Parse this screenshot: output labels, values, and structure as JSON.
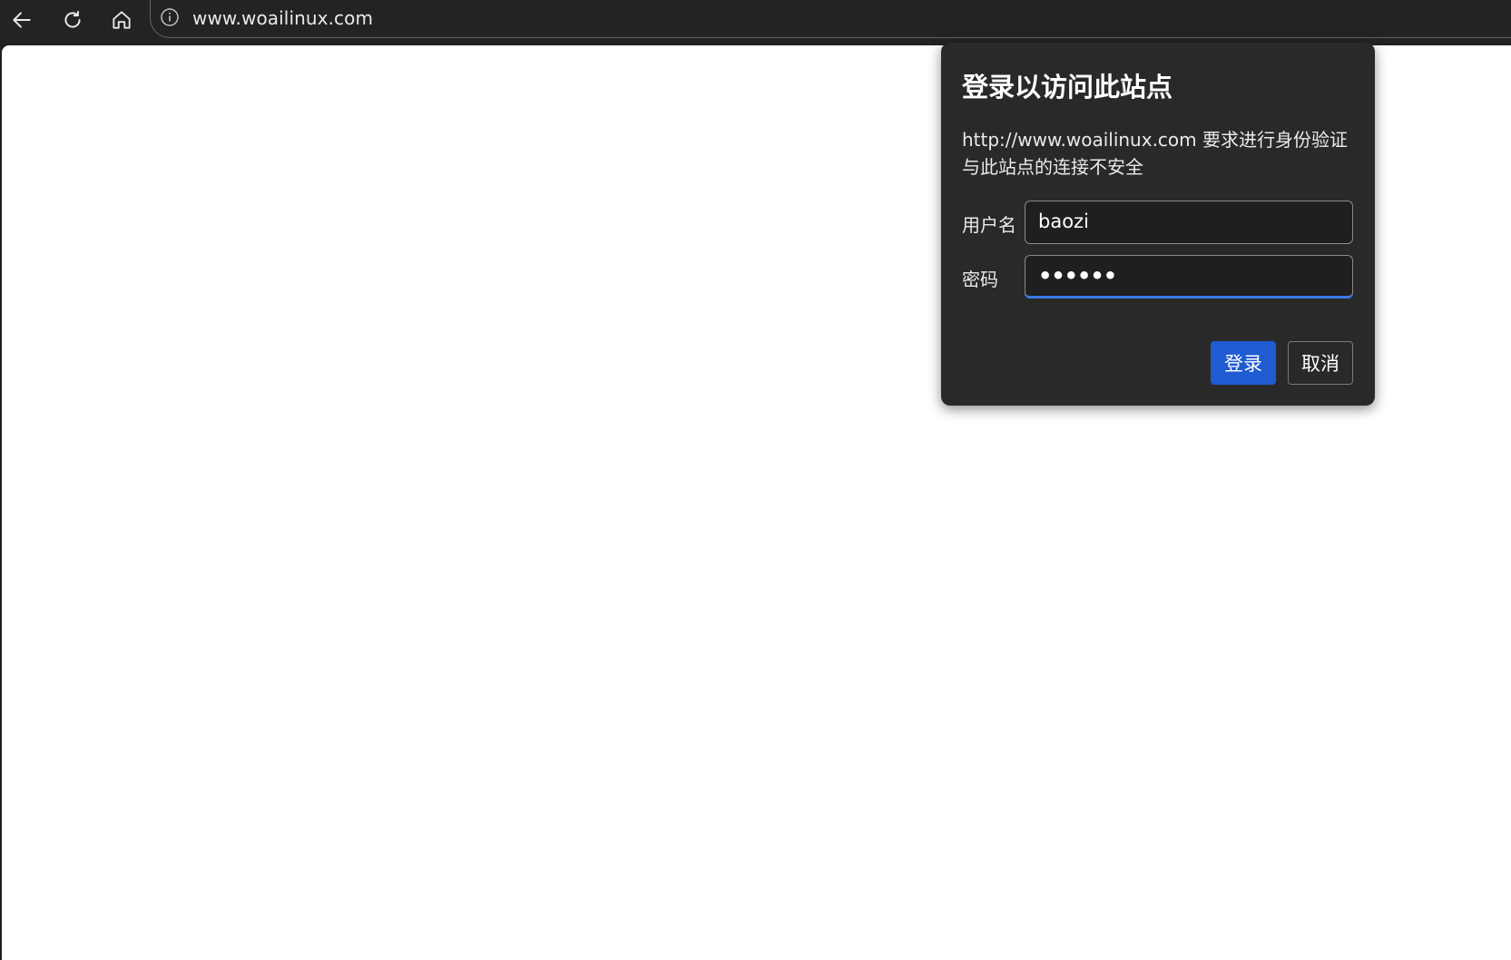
{
  "browser": {
    "url": "www.woailinux.com",
    "icons": {
      "back": "back-arrow-icon",
      "reload": "reload-icon",
      "home": "home-icon",
      "site_info": "info-icon"
    }
  },
  "auth_dialog": {
    "title": "登录以访问此站点",
    "message_line1": "http://www.woailinux.com 要求进行身份验证",
    "message_line2": "与此站点的连接不安全",
    "username_label": "用户名",
    "username_value": "baozi",
    "password_label": "密码",
    "password_value": "••••••",
    "login_button": "登录",
    "cancel_button": "取消"
  },
  "colors": {
    "toolbar_bg": "#232323",
    "dialog_bg": "#292929",
    "primary_button": "#1f5bd1",
    "focus_underline": "#3b78e7",
    "page_bg": "#ffffff"
  }
}
